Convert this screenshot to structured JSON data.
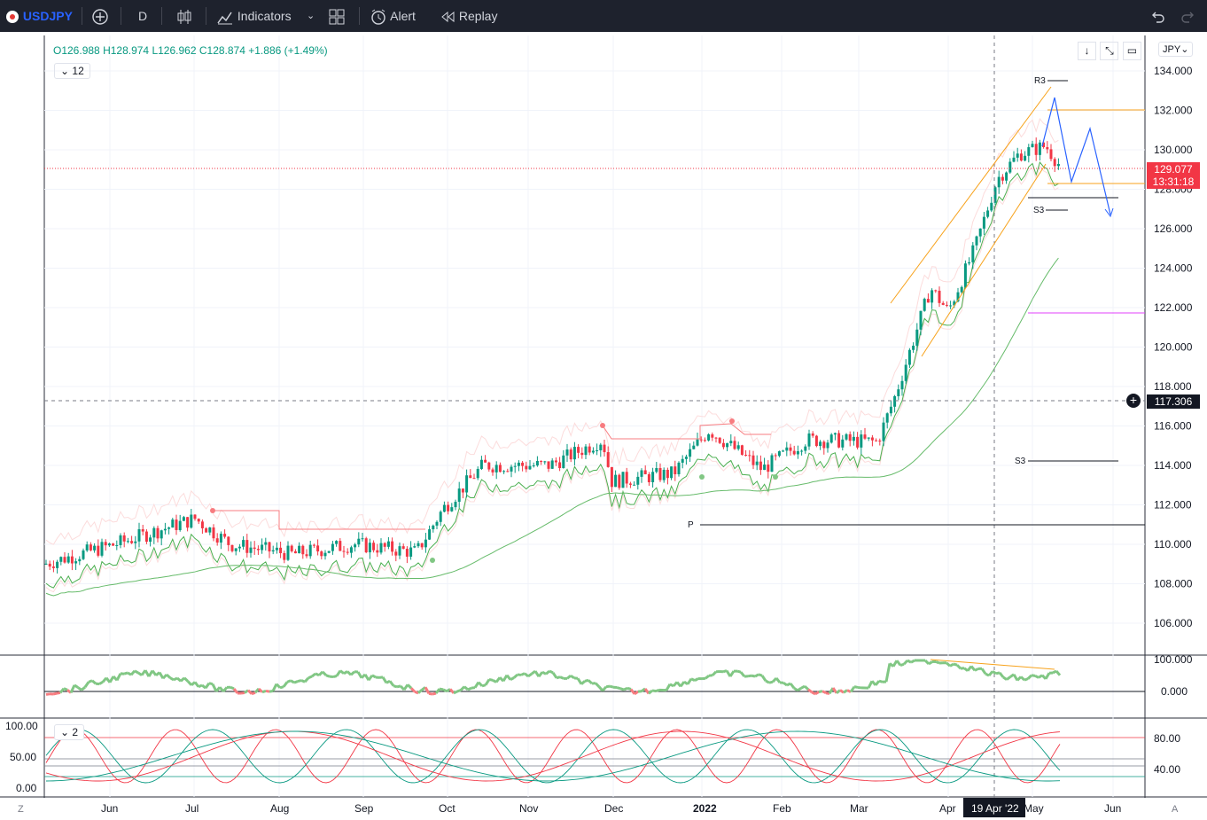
{
  "toolbar": {
    "symbol": "USDJPY",
    "interval": "D",
    "indicators_label": "Indicators",
    "alert_label": "Alert",
    "replay_label": "Replay"
  },
  "legend": {
    "open": "O126.988",
    "high": "H128.974",
    "low": "L126.962",
    "close": "C128.874",
    "change": "+1.886 (+1.49%)",
    "indicator_count": "12",
    "osc_count": "2"
  },
  "price_axis": {
    "currency": "JPY",
    "ticks": [
      "134.000",
      "132.000",
      "130.000",
      "128.000",
      "126.000",
      "124.000",
      "122.000",
      "120.000",
      "118.000",
      "116.000",
      "114.000",
      "112.000",
      "110.000",
      "108.000",
      "106.000"
    ],
    "last_price": "129.077",
    "countdown": "13:31:18",
    "crosshair_price": "117.306",
    "last_price_color": "#f23645"
  },
  "osc1_axis": {
    "ticks": [
      "100.000",
      "0.000"
    ]
  },
  "osc2_axis": {
    "left_ticks": [
      "100.00",
      "50.00",
      "0.00"
    ],
    "right_ticks": [
      "80.00",
      "40.00"
    ]
  },
  "time_axis": {
    "labels": [
      "Jun",
      "Jul",
      "Aug",
      "Sep",
      "Oct",
      "Nov",
      "Dec",
      "2022",
      "Feb",
      "Mar",
      "Apr",
      "May",
      "Jun"
    ],
    "crosshair_date": "19 Apr '22",
    "left_btn": "Z",
    "right_btn": "A"
  },
  "pivots": {
    "r3": "R3",
    "s3_upper": "S3",
    "s3_lower": "S3",
    "p": "P"
  },
  "colors": {
    "up": "#089981",
    "down": "#f23645",
    "accent": "#2962ff",
    "orange": "#f7a21b",
    "pivot_magenta": "#e040fb"
  },
  "icons": [
    "add-symbol-icon",
    "bar-style-icon",
    "indicators-icon",
    "templates-icon",
    "alert-icon",
    "replay-icon",
    "undo-icon",
    "redo-icon",
    "scroll-down-icon",
    "fullscreen-icon",
    "screenshot-icon",
    "crosshair-plus-icon"
  ]
}
